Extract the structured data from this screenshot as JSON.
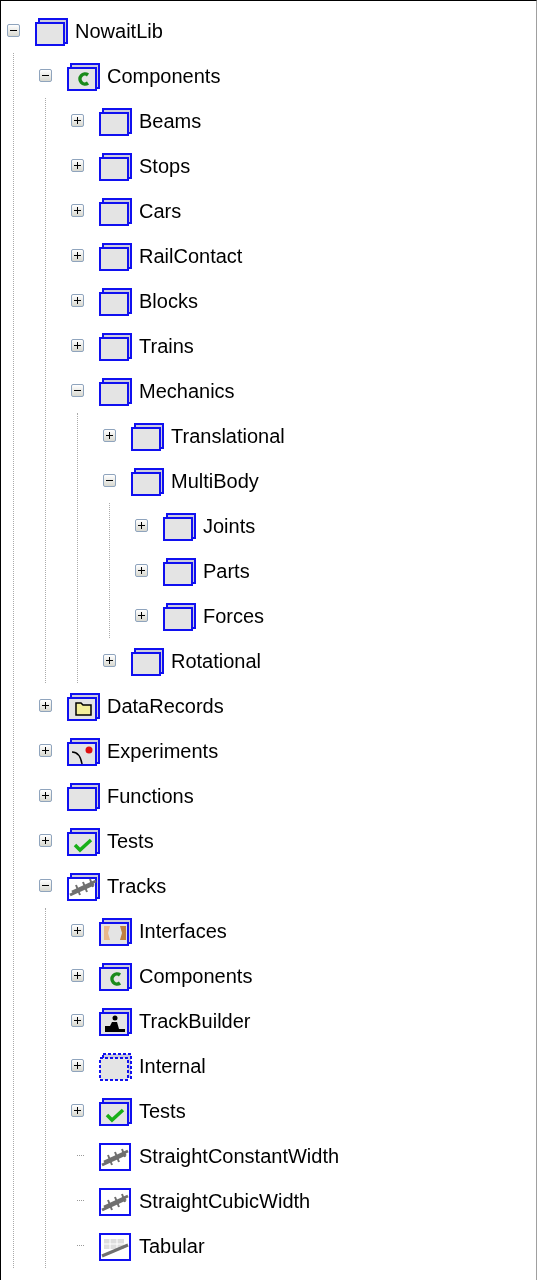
{
  "tree": [
    {
      "label": "NowaitLib",
      "kind": "package",
      "expanded": true,
      "children": [
        {
          "label": "Components",
          "kind": "components",
          "expanded": true,
          "children": [
            {
              "label": "Beams",
              "kind": "package",
              "expanded": false
            },
            {
              "label": "Stops",
              "kind": "package",
              "expanded": false
            },
            {
              "label": "Cars",
              "kind": "package",
              "expanded": false
            },
            {
              "label": "RailContact",
              "kind": "package",
              "expanded": false
            },
            {
              "label": "Blocks",
              "kind": "package",
              "expanded": false
            },
            {
              "label": "Trains",
              "kind": "package",
              "expanded": false
            },
            {
              "label": "Mechanics",
              "kind": "package",
              "expanded": true,
              "children": [
                {
                  "label": "Translational",
                  "kind": "package",
                  "expanded": false
                },
                {
                  "label": "MultiBody",
                  "kind": "package",
                  "expanded": true,
                  "children": [
                    {
                      "label": "Joints",
                      "kind": "package",
                      "expanded": false
                    },
                    {
                      "label": "Parts",
                      "kind": "package",
                      "expanded": false
                    },
                    {
                      "label": "Forces",
                      "kind": "package",
                      "expanded": false
                    }
                  ]
                },
                {
                  "label": "Rotational",
                  "kind": "package",
                  "expanded": false
                }
              ]
            }
          ]
        },
        {
          "label": "DataRecords",
          "kind": "records",
          "expanded": false
        },
        {
          "label": "Experiments",
          "kind": "experiments",
          "expanded": false
        },
        {
          "label": "Functions",
          "kind": "package",
          "expanded": false
        },
        {
          "label": "Tests",
          "kind": "tests",
          "expanded": false
        },
        {
          "label": "Tracks",
          "kind": "tracks",
          "expanded": true,
          "children": [
            {
              "label": "Interfaces",
              "kind": "interfaces",
              "expanded": false
            },
            {
              "label": "Components",
              "kind": "components",
              "expanded": false
            },
            {
              "label": "TrackBuilder",
              "kind": "builder",
              "expanded": false
            },
            {
              "label": "Internal",
              "kind": "internal",
              "expanded": false
            },
            {
              "label": "Tests",
              "kind": "tests",
              "expanded": false
            },
            {
              "label": "StraightConstantWidth",
              "kind": "model"
            },
            {
              "label": "StraightCubicWidth",
              "kind": "model"
            },
            {
              "label": "Tabular",
              "kind": "tabular"
            }
          ]
        }
      ]
    }
  ]
}
